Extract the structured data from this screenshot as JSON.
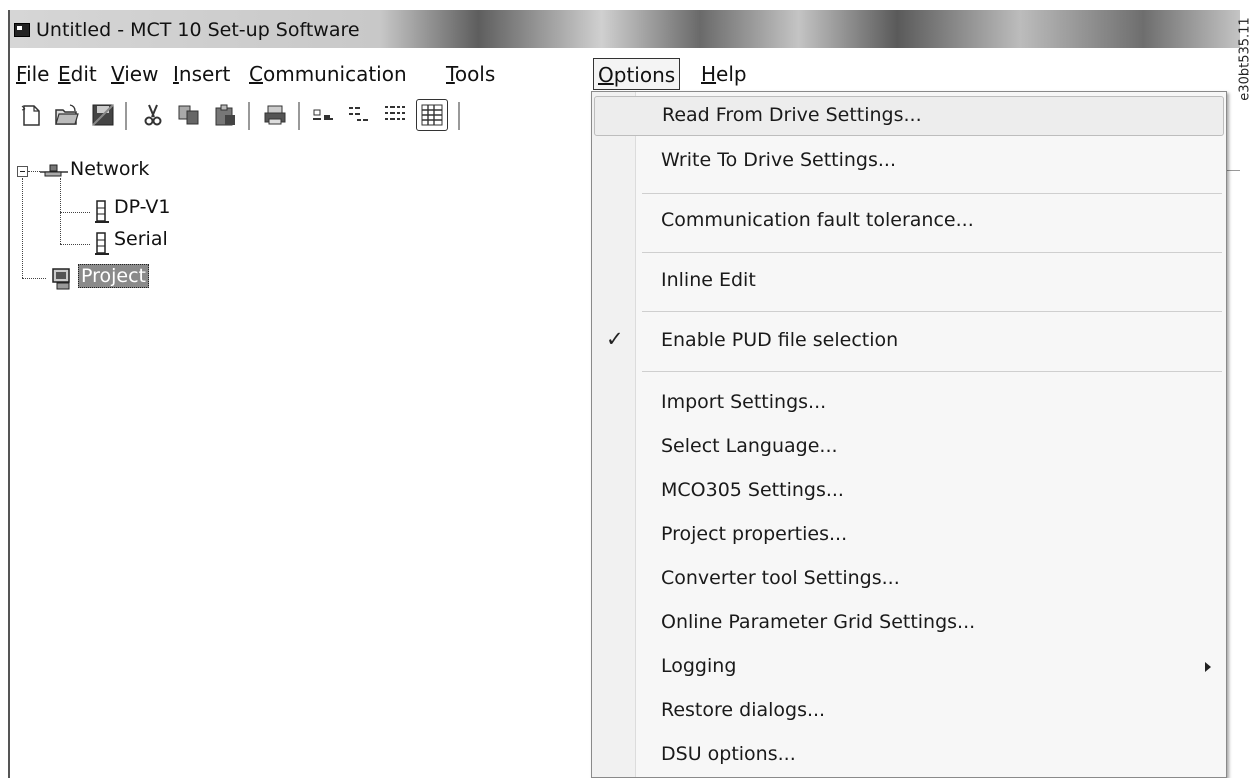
{
  "window": {
    "title": "Untitled - MCT 10 Set-up Software"
  },
  "menubar": {
    "items": [
      {
        "label": "File",
        "mnemonic": "F",
        "rest": "ile"
      },
      {
        "label": "Edit",
        "mnemonic": "E",
        "rest": "dit"
      },
      {
        "label": "View",
        "mnemonic": "V",
        "rest": "iew"
      },
      {
        "label": "Insert",
        "mnemonic": "I",
        "rest": "nsert"
      },
      {
        "label": "Communication",
        "mnemonic": "C",
        "rest": "ommunication"
      },
      {
        "label": "Tools",
        "mnemonic": "T",
        "rest": "ools"
      },
      {
        "label": "Options",
        "mnemonic": "O",
        "rest": "ptions"
      },
      {
        "label": "Help",
        "mnemonic": "H",
        "rest": "elp"
      }
    ],
    "open_menu": "Options"
  },
  "toolbar": {
    "buttons": [
      "new-icon",
      "open-icon",
      "save-icon",
      "cut-icon",
      "copy-icon",
      "paste-icon",
      "print-icon",
      "large-icons-icon",
      "small-icons-icon",
      "list-icon",
      "details-icon"
    ]
  },
  "tree": {
    "network": {
      "label": "Network"
    },
    "children": [
      {
        "label": "DP-V1"
      },
      {
        "label": "Serial"
      }
    ],
    "project": {
      "label": "Project",
      "selected": true
    }
  },
  "options_menu": {
    "items": [
      {
        "label": "Read From Drive Settings...",
        "highlighted": true
      },
      {
        "label": "Write To Drive Settings..."
      },
      {
        "label": "Communication fault tolerance..."
      },
      {
        "label": "Inline Edit"
      },
      {
        "label": "Enable PUD file selection",
        "checked": true,
        "check_glyph": "✓"
      },
      {
        "label": "Import Settings..."
      },
      {
        "label": "Select Language..."
      },
      {
        "label": "MCO305 Settings..."
      },
      {
        "label": "Project properties..."
      },
      {
        "label": "Converter tool Settings..."
      },
      {
        "label": "Online Parameter Grid Settings..."
      },
      {
        "label": "Logging",
        "submenu": true
      },
      {
        "label": "Restore dialogs..."
      },
      {
        "label": "DSU options..."
      }
    ]
  },
  "figure_id": "e30bt535.11"
}
